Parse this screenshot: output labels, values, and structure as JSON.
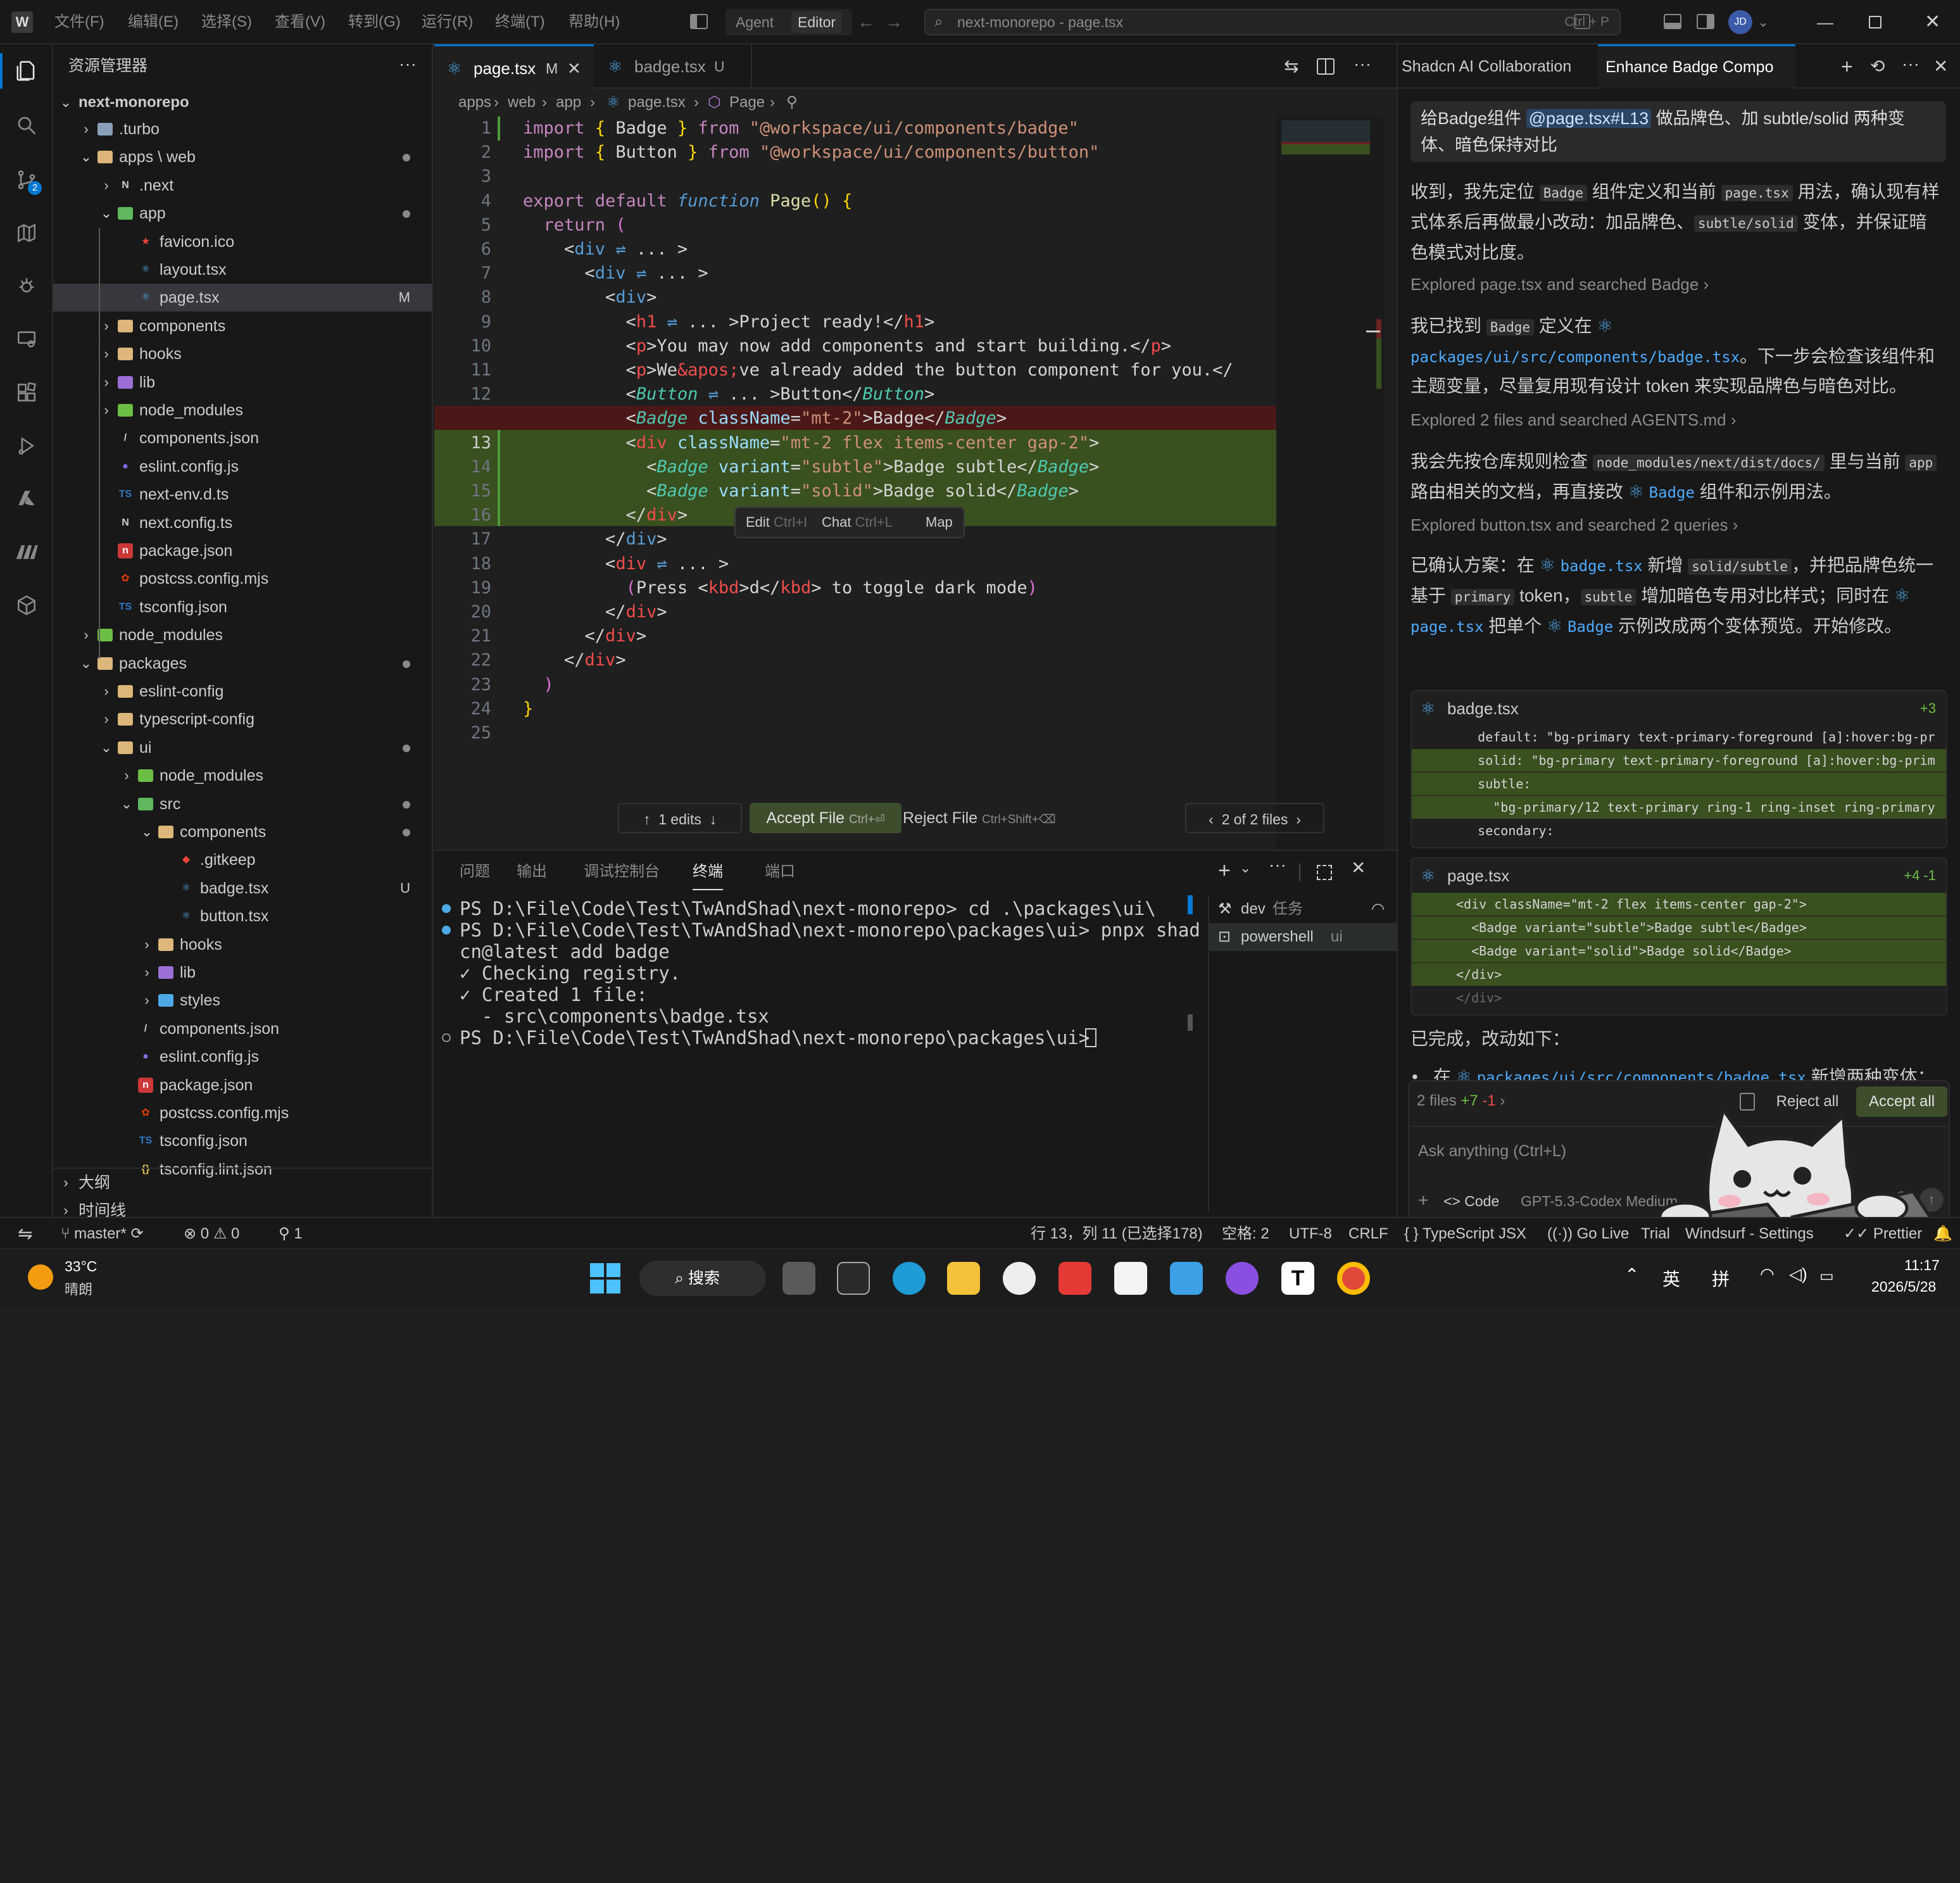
{
  "titlebar": {
    "menus": [
      "文件(F)",
      "编辑(E)",
      "选择(S)",
      "查看(V)",
      "转到(G)",
      "运行(R)",
      "终端(T)",
      "帮助(H)"
    ],
    "agent_label": "Agent",
    "editor_label": "Editor",
    "search_text": "next-monorepo - page.tsx",
    "search_shortcut": "Ctrl + P",
    "avatar_initials": "JD"
  },
  "sidebar": {
    "title": "资源管理器",
    "more": "···",
    "root": "next-monorepo",
    "rows": [
      {
        "label": ".turbo",
        "depth": 1,
        "chev": "›",
        "icon": "folder-gear",
        "color": "#8aa0b8"
      },
      {
        "label": "apps \\ web",
        "depth": 1,
        "chev": "⌄",
        "icon": "folder",
        "color": "#dcb67a",
        "dot": true
      },
      {
        "label": ".next",
        "depth": 2,
        "chev": "›",
        "icon": "next",
        "color": "#cccccc"
      },
      {
        "label": "app",
        "depth": 2,
        "chev": "⌄",
        "icon": "folder-app",
        "color": "#5fb85f",
        "dot": true
      },
      {
        "label": "favicon.ico",
        "depth": 3,
        "chev": "",
        "icon": "star",
        "color": "#e8453c"
      },
      {
        "label": "layout.tsx",
        "depth": 3,
        "chev": "",
        "icon": "react",
        "color": "#4fa9e6"
      },
      {
        "label": "page.tsx",
        "depth": 3,
        "chev": "",
        "icon": "react",
        "color": "#4fa9e6",
        "badge": "M",
        "selected": true
      },
      {
        "label": "components",
        "depth": 2,
        "chev": "›",
        "icon": "folder",
        "color": "#dcb67a"
      },
      {
        "label": "hooks",
        "depth": 2,
        "chev": "›",
        "icon": "folder",
        "color": "#dcb67a"
      },
      {
        "label": "lib",
        "depth": 2,
        "chev": "›",
        "icon": "folder",
        "color": "#9b6fd6"
      },
      {
        "label": "node_modules",
        "depth": 2,
        "chev": "›",
        "icon": "folder",
        "color": "#6dbe45"
      },
      {
        "label": "components.json",
        "depth": 2,
        "chev": "",
        "icon": "slash",
        "color": "#cccccc"
      },
      {
        "label": "eslint.config.js",
        "depth": 2,
        "chev": "",
        "icon": "eslint",
        "color": "#7c6fe6"
      },
      {
        "label": "next-env.d.ts",
        "depth": 2,
        "chev": "",
        "icon": "ts",
        "color": "#3178c6"
      },
      {
        "label": "next.config.ts",
        "depth": 2,
        "chev": "",
        "icon": "next",
        "color": "#cccccc"
      },
      {
        "label": "package.json",
        "depth": 2,
        "chev": "",
        "icon": "npm",
        "color": "#cb3837"
      },
      {
        "label": "postcss.config.mjs",
        "depth": 2,
        "chev": "",
        "icon": "postcss",
        "color": "#dd3a0a"
      },
      {
        "label": "tsconfig.json",
        "depth": 2,
        "chev": "",
        "icon": "ts",
        "color": "#3178c6"
      },
      {
        "label": "node_modules",
        "depth": 1,
        "chev": "›",
        "icon": "folder",
        "color": "#6dbe45"
      },
      {
        "label": "packages",
        "depth": 1,
        "chev": "⌄",
        "icon": "folder",
        "color": "#dcb67a",
        "dot": true
      },
      {
        "label": "eslint-config",
        "depth": 2,
        "chev": "›",
        "icon": "folder",
        "color": "#dcb67a"
      },
      {
        "label": "typescript-config",
        "depth": 2,
        "chev": "›",
        "icon": "folder",
        "color": "#dcb67a"
      },
      {
        "label": "ui",
        "depth": 2,
        "chev": "⌄",
        "icon": "folder",
        "color": "#dcb67a",
        "dot": true
      },
      {
        "label": "node_modules",
        "depth": 3,
        "chev": "›",
        "icon": "folder",
        "color": "#6dbe45"
      },
      {
        "label": "src",
        "depth": 3,
        "chev": "⌄",
        "icon": "folder",
        "color": "#5fb85f",
        "dot": true
      },
      {
        "label": "components",
        "depth": 4,
        "chev": "⌄",
        "icon": "folder",
        "color": "#dcb67a",
        "dot": true
      },
      {
        "label": ".gitkeep",
        "depth": 5,
        "chev": "",
        "icon": "git",
        "color": "#e8453c"
      },
      {
        "label": "badge.tsx",
        "depth": 5,
        "chev": "",
        "icon": "react",
        "color": "#4fa9e6",
        "badge": "U"
      },
      {
        "label": "button.tsx",
        "depth": 5,
        "chev": "",
        "icon": "react",
        "color": "#4fa9e6"
      },
      {
        "label": "hooks",
        "depth": 4,
        "chev": "›",
        "icon": "folder",
        "color": "#dcb67a"
      },
      {
        "label": "lib",
        "depth": 4,
        "chev": "›",
        "icon": "folder",
        "color": "#9b6fd6"
      },
      {
        "label": "styles",
        "depth": 4,
        "chev": "›",
        "icon": "folder",
        "color": "#4fa9e6"
      },
      {
        "label": "components.json",
        "depth": 3,
        "chev": "",
        "icon": "slash",
        "color": "#cccccc"
      },
      {
        "label": "eslint.config.js",
        "depth": 3,
        "chev": "",
        "icon": "eslint",
        "color": "#7c6fe6"
      },
      {
        "label": "package.json",
        "depth": 3,
        "chev": "",
        "icon": "npm",
        "color": "#cb3837"
      },
      {
        "label": "postcss.config.mjs",
        "depth": 3,
        "chev": "",
        "icon": "postcss",
        "color": "#dd3a0a"
      },
      {
        "label": "tsconfig.json",
        "depth": 3,
        "chev": "",
        "icon": "ts",
        "color": "#3178c6"
      },
      {
        "label": "tsconfig.lint.json",
        "depth": 3,
        "chev": "",
        "icon": "braces",
        "color": "#e0c050"
      }
    ],
    "outline": "大纲",
    "timeline": "时间线"
  },
  "editor": {
    "tabs": [
      {
        "label": "page.tsx",
        "status": "M",
        "active": true
      },
      {
        "label": "badge.tsx",
        "status": "U",
        "active": false
      }
    ],
    "breadcrumb": [
      "apps",
      "web",
      "app",
      "page.tsx",
      "Page"
    ],
    "inline_menu": {
      "edit": "Edit",
      "edit_key": "Ctrl+I",
      "chat": "Chat",
      "chat_key": "Ctrl+L",
      "map": "Map"
    },
    "review_bar": {
      "edits": "1 edits",
      "accept": "Accept File",
      "accept_key": "Ctrl+⏎",
      "reject": "Reject File",
      "reject_key": "Ctrl+Shift+⌫",
      "files": "2 of 2 files"
    }
  },
  "panel": {
    "tabs": [
      "问题",
      "输出",
      "调试控制台",
      "终端",
      "端口"
    ],
    "active_tab": "终端",
    "terminal_lines": [
      "PS D:\\File\\Code\\Test\\TwAndShad\\next-monorepo> cd .\\packages\\ui\\",
      "PS D:\\File\\Code\\Test\\TwAndShad\\next-monorepo\\packages\\ui> pnpx shad",
      "cn@latest add badge",
      "✓ Checking registry.",
      "✓ Created 1 file:",
      "  - src\\components\\badge.tsx",
      "PS D:\\File\\Code\\Test\\TwAndShad\\next-monorepo\\packages\\ui> "
    ],
    "terminals": [
      {
        "name": "dev",
        "task": "任务"
      },
      {
        "name": "powershell",
        "task": "ui"
      }
    ]
  },
  "chat": {
    "tabs": [
      "Shadcn AI Collaboration",
      "Enhance Badge Compo"
    ],
    "user_prompt_a": "给Badge组件 ",
    "user_prompt_ref": "@page.tsx#L13",
    "user_prompt_b": " 做品牌色、加 subtle/solid 两种变体、暗色保持对比",
    "p1_a": "收到，我先定位 ",
    "p1_c1": "Badge",
    "p1_b": " 组件定义和当前 ",
    "p1_c2": "page.tsx",
    "p1_c": " 用法，确认现有样式体系后再做最小改动：加品牌色、",
    "p1_c3": "subtle/solid",
    "p1_d": " 变体，并保证暗色模式对比度。",
    "explored1": "Explored page.tsx and searched Badge",
    "p2_a": "我已找到 ",
    "p2_c1": "Badge",
    "p2_b": " 定义在 ",
    "p2_link": "packages/ui/src/components/badge.tsx",
    "p2_c": "。下一步会检查该组件和主题变量，尽量复用现有设计 token 来实现品牌色与暗色对比。",
    "explored2": "Explored 2 files and searched AGENTS.md",
    "p3_a": "我会先按仓库规则检查 ",
    "p3_c1": "node_modules/next/dist/docs/",
    "p3_b": " 里与当前 ",
    "p3_c2": "app",
    "p3_c": " 路由相关的文档，再直接改 ",
    "p3_link": "Badge",
    "p3_d": " 组件和示例用法。",
    "explored3": "Explored button.tsx and searched 2 queries",
    "p4_a": "已确认方案：在 ",
    "p4_link1": "badge.tsx",
    "p4_b": " 新增 ",
    "p4_c1": "solid/subtle",
    "p4_c": "，并把品牌色统一基于 ",
    "p4_c2": "primary",
    "p4_d": " token，",
    "p4_c3": "subtle",
    "p4_e": " 增加暗色专用对比样式；同时在 ",
    "p4_link2": "page.tsx",
    "p4_f": " 把单个 ",
    "p4_link3": "Badge",
    "p4_g": " 示例改成两个变体预览。开始修改。",
    "diff1": {
      "file": "badge.tsx",
      "stat": "+3",
      "lines": [
        "    default: \"bg-primary text-primary-foreground [a]:hover:bg-pr",
        "    solid: \"bg-primary text-primary-foreground [a]:hover:bg-prim",
        "    subtle:",
        "      \"bg-primary/12 text-primary ring-1 ring-inset ring-primary",
        "    secondary:"
      ]
    },
    "diff2": {
      "file": "page.tsx",
      "stat": "+4 -1",
      "lines": [
        "<div className=\"mt-2 flex items-center gap-2\">",
        "  <Badge variant=\"subtle\">Badge subtle</Badge>",
        "  <Badge variant=\"solid\">Badge solid</Badge>",
        "</div>",
        "</div>"
      ]
    },
    "done": "已完成，改动如下：",
    "bullet_a": "在 ",
    "bullet_link": "packages/ui/src/components/badge.tsx",
    "bullet_b": " 新增两种变体：",
    "files_summary": "2 files",
    "files_plus": "+7",
    "files_minus": "-1",
    "reject_all": "Reject all",
    "accept_all": "Accept all",
    "input_placeholder": "Ask anything (Ctrl+L)",
    "mode": "Code",
    "model": "GPT-5.3-Codex",
    "effort": "Medium"
  },
  "statusbar": {
    "branch": "master*",
    "errors": "0",
    "warnings": "0",
    "ports": "1",
    "position": "行 13，列 11 (已选择178)",
    "spaces": "空格: 2",
    "encoding": "UTF-8",
    "eol": "CRLF",
    "language": "TypeScript JSX",
    "golive": "Go Live",
    "trial": "Trial",
    "windsurf": "Windsurf - Settings",
    "prettier": "Prettier"
  },
  "taskbar": {
    "temp": "33°C",
    "weather": "晴朗",
    "search": "搜索",
    "ime1": "英",
    "ime2": "拼",
    "time": "11:17",
    "date": "2026/5/28"
  }
}
